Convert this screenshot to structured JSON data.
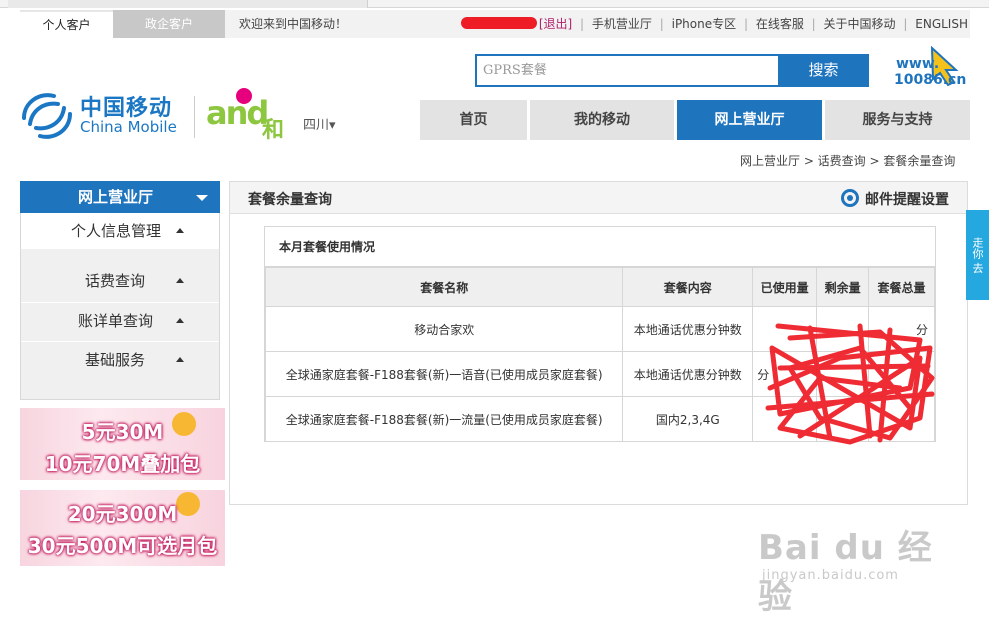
{
  "topbar": {
    "tab_personal": "个人客户",
    "tab_gov": "政企客户",
    "welcome": "欢迎来到中国移动！",
    "logout": "[退出]",
    "links": [
      "手机营业厅",
      "iPhone专区",
      "在线客服",
      "关于中国移动",
      "ENGLISH"
    ]
  },
  "search": {
    "placeholder": "GPRS套餐",
    "button": "搜索"
  },
  "brand": {
    "cm_cn": "中国移动",
    "cm_en": "China Mobile",
    "and_text": "and",
    "he_text": "和",
    "province": "四川▾",
    "site_10086_top": "www.",
    "site_10086_bottom": "10086.cn"
  },
  "mainnav": [
    "首页",
    "我的移动",
    "网上营业厅",
    "服务与支持"
  ],
  "breadcrumb": "网上营业厅 > 话费查询 > 套餐余量查询",
  "sidebar": {
    "header": "网上营业厅",
    "items": [
      "个人信息管理",
      "话费查询",
      "账详单查询",
      "基础服务"
    ]
  },
  "promos": [
    {
      "line1": "5元30M",
      "line2": "10元70M叠加包"
    },
    {
      "line1": "20元300M",
      "line2": "30元500M可选月包"
    }
  ],
  "panel": {
    "title": "套餐余量查询",
    "mail_setting": "邮件提醒设置",
    "table_caption": "本月套餐使用情况",
    "columns": [
      "套餐名称",
      "套餐内容",
      "已使用量",
      "剩余量",
      "套餐总量"
    ],
    "rows": [
      [
        "移动合家欢",
        "本地通话优惠分钟数",
        "",
        "",
        "分"
      ],
      [
        "全球通家庭套餐-F188套餐(新)一语音(已使用成员家庭套餐)",
        "本地通话优惠分钟数",
        "分",
        "",
        ""
      ],
      [
        "全球通家庭套餐-F188套餐(新)一流量(已使用成员家庭套餐)",
        "国内2,3,4G",
        "",
        "",
        ""
      ]
    ]
  },
  "side_float": "走你 去",
  "watermark": {
    "big": "Bai du 经验",
    "small": "jingyan.baidu.com"
  },
  "colors": {
    "primary": "#1f74be",
    "scribble": "#ee1c25",
    "accent_green": "#8dc63f"
  }
}
